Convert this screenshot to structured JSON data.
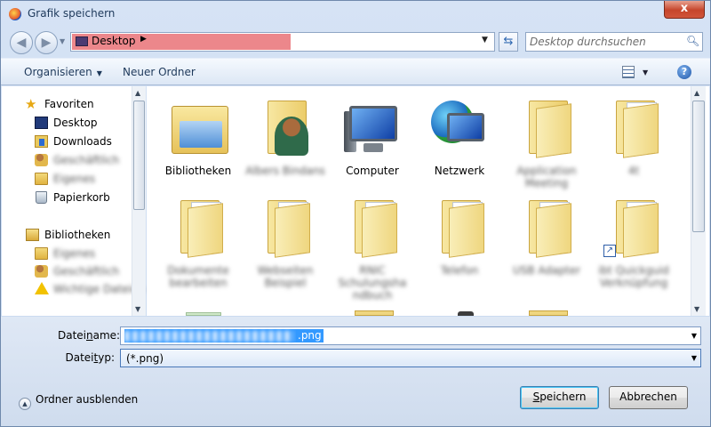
{
  "window": {
    "title": "Grafik speichern",
    "close": "x"
  },
  "nav": {
    "address": "Desktop",
    "search_placeholder": "Desktop durchsuchen"
  },
  "toolbar": {
    "organize": "Organisieren",
    "new_folder": "Neuer Ordner",
    "help": "?"
  },
  "tree": [
    {
      "label": "Favoriten",
      "icon": "star-icon"
    },
    {
      "label": "Desktop",
      "icon": "desktop-icon"
    },
    {
      "label": "Downloads",
      "icon": "downloads-icon"
    },
    {
      "label": "Geschäftlich",
      "icon": "user-folder-icon",
      "blurred": true
    },
    {
      "label": "Eigenes",
      "icon": "user-folder-icon",
      "blurred": true
    },
    {
      "label": "Papierkorb",
      "icon": "recycle-bin-icon"
    },
    {
      "label": "Bibliotheken",
      "icon": "libraries-icon"
    },
    {
      "label": "Eigenes",
      "icon": "user-folder-icon",
      "blurred": true
    },
    {
      "label": "Geschäftlich",
      "icon": "user-folder-icon",
      "blurred": true
    },
    {
      "label": "Wichtige Dateien",
      "icon": "warning-icon",
      "blurred": true
    }
  ],
  "items": [
    {
      "label": "Bibliotheken",
      "icon": "libraries-icon"
    },
    {
      "label": "Albers Bindans",
      "icon": "user-folder-icon",
      "blurred": true
    },
    {
      "label": "Computer",
      "icon": "computer-icon"
    },
    {
      "label": "Netzwerk",
      "icon": "network-icon"
    },
    {
      "label": "Application Meeting",
      "icon": "folder-icon",
      "blurred": true
    },
    {
      "label": "4t",
      "icon": "folder-icon",
      "blurred": true
    },
    {
      "label": "Dokumente bearbeiten",
      "icon": "folder-icon",
      "blurred": true
    },
    {
      "label": "Webseiten Beispiel",
      "icon": "folder-icon",
      "blurred": true
    },
    {
      "label": "RNIC Schulungsha ndbuch",
      "icon": "folder-icon",
      "blurred": true
    },
    {
      "label": "Telefon",
      "icon": "folder-icon",
      "blurred": true
    },
    {
      "label": "USB Adapter",
      "icon": "folder-icon",
      "blurred": true
    },
    {
      "label": "ibt Quickguid Verknüpfung",
      "icon": "folder-shortcut-icon",
      "blurred": true
    }
  ],
  "bottom": {
    "filename_label_pre": "Datei",
    "filename_label_u": "n",
    "filename_label_post": "ame:",
    "filename_ext": ".png",
    "filetype_label_pre": "Datei",
    "filetype_label_u": "t",
    "filetype_label_post": "yp:",
    "filetype_value": "(*.png)",
    "hide_folders": "Ordner ausblenden",
    "save_pre": "",
    "save_u": "S",
    "save_post": "peichern",
    "cancel": "Abbrechen"
  }
}
